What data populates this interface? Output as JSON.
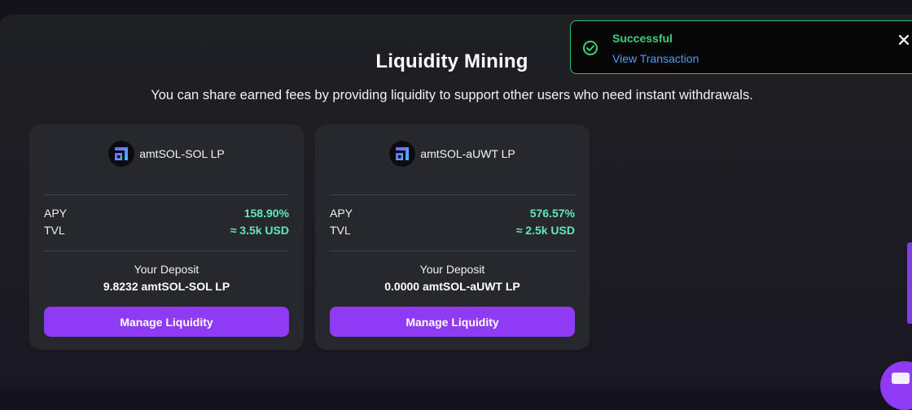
{
  "header": {
    "title": "Liquidity Mining",
    "subtitle": "You can share earned fees by providing liquidity to support other users who need instant withdrawals."
  },
  "pools": [
    {
      "name": "amtSOL-SOL LP",
      "apy_label": "APY",
      "apy_value": "158.90%",
      "tvl_label": "TVL",
      "tvl_value": "≈ 3.5k USD",
      "deposit_label": "Your Deposit",
      "deposit_value": "9.8232 amtSOL-SOL LP",
      "button_label": "Manage Liquidity"
    },
    {
      "name": "amtSOL-aUWT LP",
      "apy_label": "APY",
      "apy_value": "576.57%",
      "tvl_label": "TVL",
      "tvl_value": "≈ 2.5k USD",
      "deposit_label": "Your Deposit",
      "deposit_value": "0.0000 amtSOL-aUWT LP",
      "button_label": "Manage Liquidity"
    }
  ],
  "toast": {
    "title": "Successful",
    "link_label": "View Transaction"
  },
  "colors": {
    "accent": "#8f3bf5",
    "positive": "#5ee8c1",
    "success": "#3ccf7c",
    "link": "#4f9cf6"
  },
  "icons": {
    "pool_logo": "amt-logo-icon",
    "toast_status": "check-circle-icon",
    "toast_close": "close-icon",
    "chat": "chat-icon"
  }
}
